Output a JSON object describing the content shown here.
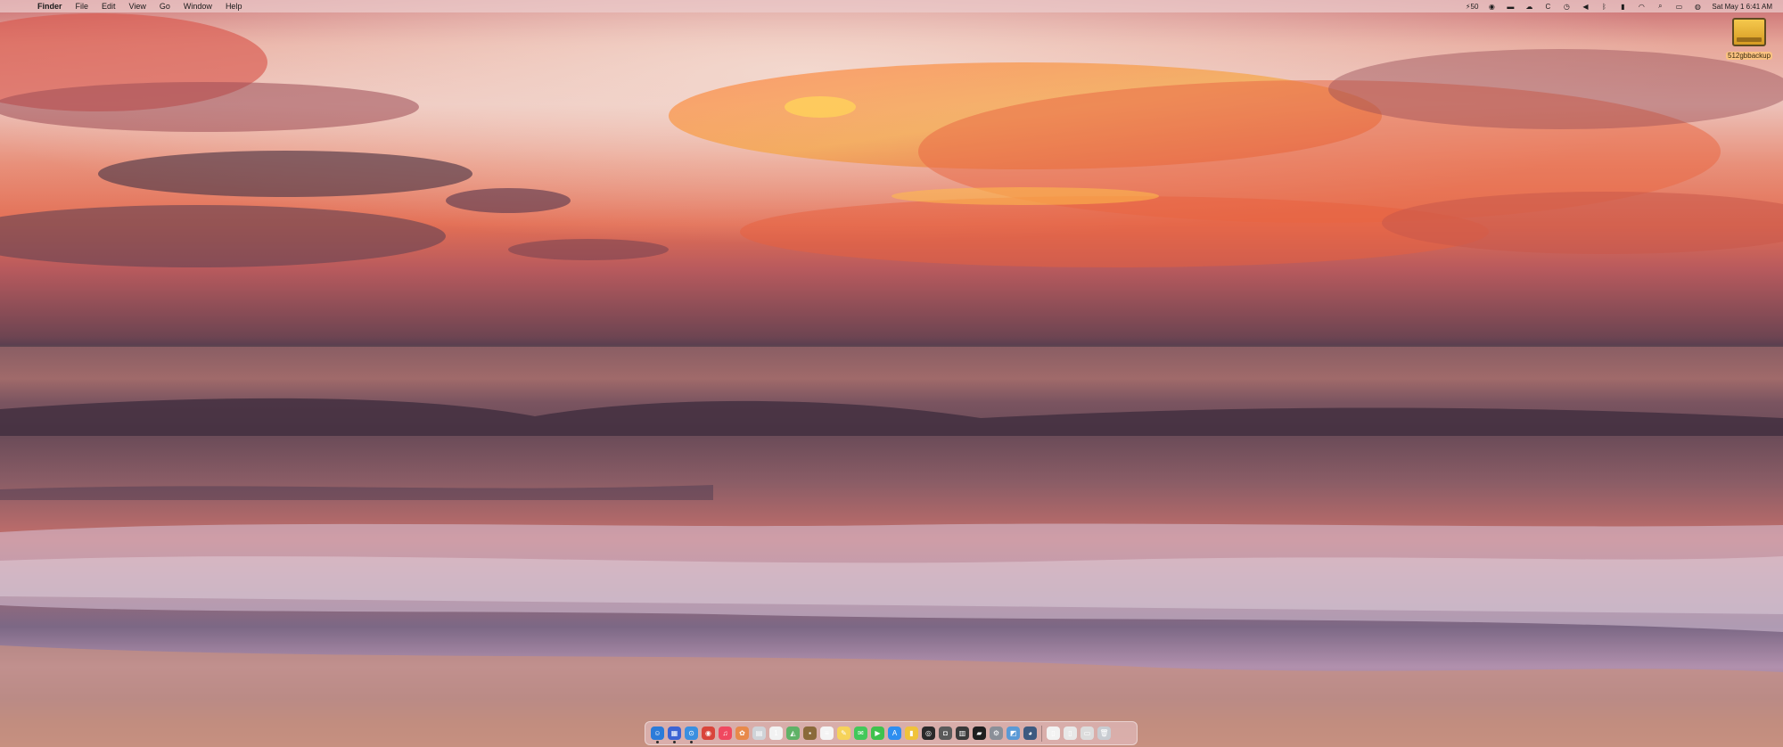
{
  "menubar": {
    "apple_glyph": "",
    "app_name": "Finder",
    "menus": [
      "File",
      "Edit",
      "View",
      "Go",
      "Window",
      "Help"
    ],
    "status": {
      "battery_charge": "50",
      "clock": "Sat May 1  6:41 AM"
    },
    "status_icons": [
      "bolt-icon",
      "record-icon",
      "screen-icon",
      "cloud-icon",
      "c-icon",
      "time-machine-icon",
      "volume-icon",
      "bluetooth-icon",
      "battery-icon",
      "wifi-icon",
      "search-icon",
      "control-center-icon",
      "siri-icon"
    ]
  },
  "desktop": {
    "drive_label": "512gbbackup"
  },
  "dock": {
    "apps": [
      {
        "name": "finder",
        "color": "#2b7bd9",
        "glyph": "☺",
        "running": true
      },
      {
        "name": "launchpad",
        "color": "#3c64d4",
        "glyph": "▦",
        "running": true
      },
      {
        "name": "safari",
        "color": "#3a8fe0",
        "glyph": "⊙",
        "running": true
      },
      {
        "name": "chrome",
        "color": "#d9453b",
        "glyph": "◉",
        "running": false
      },
      {
        "name": "music",
        "color": "#f04860",
        "glyph": "♫",
        "running": false
      },
      {
        "name": "photos",
        "color": "#e8894a",
        "glyph": "✿",
        "running": false
      },
      {
        "name": "widgets",
        "color": "#cfd3d8",
        "glyph": "▤",
        "running": false
      },
      {
        "name": "calendar",
        "color": "#f2f2f2",
        "glyph": "1",
        "running": false
      },
      {
        "name": "maps",
        "color": "#5fb267",
        "glyph": "◭",
        "running": false
      },
      {
        "name": "notes-brown",
        "color": "#8a6a3a",
        "glyph": "▪",
        "running": false
      },
      {
        "name": "reminders",
        "color": "#f4f4f4",
        "glyph": "≡",
        "running": false
      },
      {
        "name": "notes",
        "color": "#f6d35a",
        "glyph": "✎",
        "running": false
      },
      {
        "name": "messages",
        "color": "#43c85a",
        "glyph": "✉",
        "running": false
      },
      {
        "name": "facetime",
        "color": "#3ec24d",
        "glyph": "▶",
        "running": false
      },
      {
        "name": "app-store",
        "color": "#2d8ef0",
        "glyph": "A",
        "running": false
      },
      {
        "name": "notes-yellow",
        "color": "#f0c33a",
        "glyph": "▮",
        "running": false
      },
      {
        "name": "activity-monitor",
        "color": "#2a2a2a",
        "glyph": "◎",
        "running": false
      },
      {
        "name": "screenshot",
        "color": "#5a5a5a",
        "glyph": "◘",
        "running": false
      },
      {
        "name": "calculator",
        "color": "#3a3a3a",
        "glyph": "▥",
        "running": false
      },
      {
        "name": "terminal",
        "color": "#1f1f1f",
        "glyph": "▰",
        "running": false
      },
      {
        "name": "system-preferences",
        "color": "#8a8f98",
        "glyph": "⚙",
        "running": false
      },
      {
        "name": "preview",
        "color": "#5a9ad6",
        "glyph": "◩",
        "running": false
      },
      {
        "name": "quicktime",
        "color": "#3d5a80",
        "glyph": "◕",
        "running": false
      }
    ],
    "recent": [
      {
        "name": "document-1",
        "color": "#f2f2f2",
        "glyph": "▯"
      },
      {
        "name": "document-2",
        "color": "#e8e8e8",
        "glyph": "▯"
      },
      {
        "name": "document-3",
        "color": "#dcdcdc",
        "glyph": "▭"
      },
      {
        "name": "trash",
        "color": "#c8ccd2",
        "glyph": "🗑"
      }
    ]
  }
}
